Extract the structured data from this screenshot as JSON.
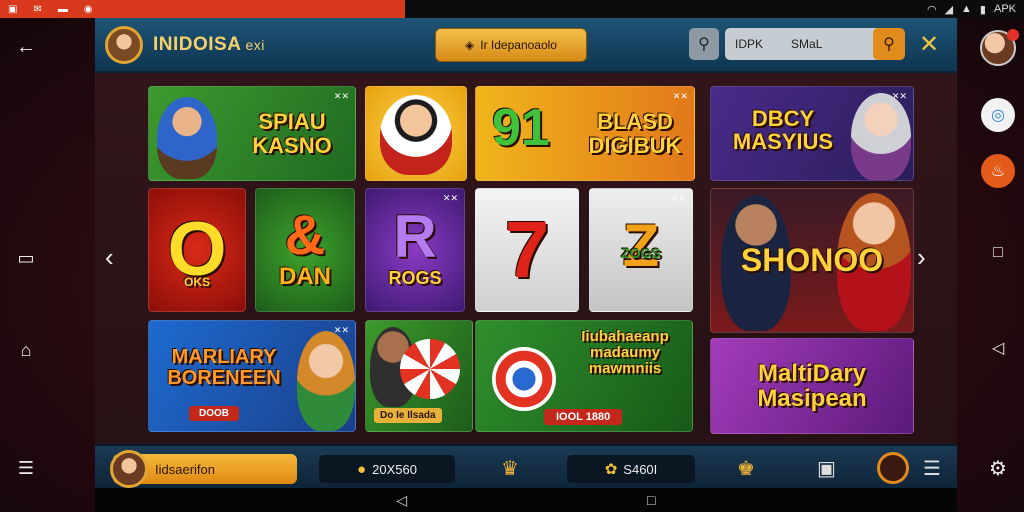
{
  "status_bar": {
    "left_icons": [
      "sim-icon",
      "mail-icon",
      "message-icon",
      "location-icon"
    ],
    "right_text": "APK",
    "accent_color": "#d9391c"
  },
  "header": {
    "brand": "INIDOISA",
    "brand_suffix": "exi",
    "promo_label": "Ir Idepanoaolo",
    "search_text": "IDPK",
    "search_text2": "SMaL",
    "colors": {
      "header_bg": "#1d5476",
      "accent": "#f0c640"
    }
  },
  "tiles": [
    {
      "id": "spiau-kasno",
      "title": "SPIAU KASNO",
      "bg": "#2f7d2a"
    },
    {
      "id": "cartoon",
      "title": "",
      "bg": "#f1b81f"
    },
    {
      "id": "blasd-digibek",
      "title": "BLASD DIGIBUK",
      "number": "91",
      "bg": "#e39417"
    },
    {
      "id": "dbcy-masyius",
      "title": "DBCY MASYIUS",
      "bg": "#5a2c94"
    },
    {
      "id": "red-o",
      "title": "OKS",
      "big": "O",
      "bg": "#c4200f"
    },
    {
      "id": "dan",
      "title": "DAN",
      "big": "&",
      "bg": "#2e8a2c"
    },
    {
      "id": "rogs",
      "title": "ROGS",
      "big": "R",
      "bg": "#6a2fa0"
    },
    {
      "id": "seven",
      "title": "",
      "big": "7",
      "bg": "#e9e9e9"
    },
    {
      "id": "zogs",
      "title": "ZOGS",
      "big": "Z",
      "bg": "#dcdcdc"
    },
    {
      "id": "shonoo",
      "title": "SHONOO",
      "bg": "#1f2c52"
    },
    {
      "id": "marliary",
      "title": "MARLIARY BORENEEN",
      "sub": "DOOB",
      "bg": "#1e5db0"
    },
    {
      "id": "chip",
      "title": "",
      "sub": "Do Ie Ilsada",
      "bg": "#2c7a24"
    },
    {
      "id": "mabia",
      "title": "Iiubahaeanp madaumy mawmniis",
      "sub": "IOOL 1880",
      "bg": "#2e8a2c"
    },
    {
      "id": "maltidary",
      "title": "MaltiDary Masipean",
      "bg": "#8a2fa4"
    }
  ],
  "bottom_bar": {
    "username": "Iidsaerifon",
    "coins_1": "20X560",
    "coins_2": "S460I"
  }
}
